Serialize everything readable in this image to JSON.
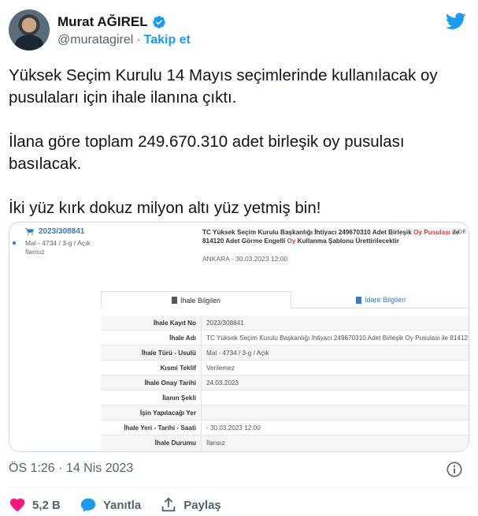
{
  "author": {
    "name": "Murat AĞIREL",
    "handle": "@muratagirel",
    "separator": "·",
    "follow_label": "Takip et"
  },
  "tweet": {
    "paragraphs": [
      "Yüksek Seçim Kurulu 14 Mayıs seçimlerinde kullanılacak oy pusulaları için ihale ilanına çıktı.",
      "İlana göre toplam 249.670.310 adet birleşik oy pusulası basılacak.",
      "İki yüz kırk dokuz milyon altı yüz yetmiş bin!"
    ],
    "timestamp": "ÖS 1:26 · 14 Nis 2023"
  },
  "media": {
    "registration": "2023/308841",
    "left_line1": "Mal - 4734 / 3-g / Açık",
    "left_line2": "İlansız",
    "title_part1": "TC Yüksek Seçim Kurulu Başkanlığı İhtiyacı 249670310 Adet Birleşik ",
    "title_red1": "Oy Pusulası",
    "title_part2": " ile 814120 Adet Görme Engelli ",
    "title_red2": "Oy",
    "title_part3": " Kullanma Şablonu Ürettirilecektir",
    "location_date": "ANKARA - 30.03.2023 12:00",
    "corner_text": "DE",
    "tab_ihale": "İhale Bilgileri",
    "tab_idare": "İdare Bilgileri",
    "rows": [
      {
        "key": "İhale Kayıt No",
        "value": "2023/308841"
      },
      {
        "key": "İhale Adı",
        "value": "TC Yüksek Seçim Kurulu Başkanlığı İhtiyacı 249670310 Adet Birleşik Oy Pusulası ile 81412"
      },
      {
        "key": "İhale Türü - Usulü",
        "value": "Mal - 4734 / 3-g / Açık"
      },
      {
        "key": "Kısmi Teklif",
        "value": "Verilemez"
      },
      {
        "key": "İhale Onay Tarihi",
        "value": "24.03.2023"
      },
      {
        "key": "İlanın Şekli",
        "value": ""
      },
      {
        "key": "İşin Yapılacağı Yer",
        "value": ""
      },
      {
        "key": "İhale Yeri - Tarihi - Saati",
        "value": "- 30.03.2023 12:00"
      },
      {
        "key": "İhale Durumu",
        "value": "İlansız"
      }
    ]
  },
  "actions": {
    "like_count": "5,2 B",
    "reply_label": "Yanıtla",
    "share_label": "Paylaş"
  },
  "colors": {
    "accent": "#1d9bf0",
    "like": "#f91880",
    "muted": "#536471"
  },
  "icons": [
    "verified-badge-icon",
    "twitter-bird-icon",
    "cart-icon",
    "info-icon",
    "heart-icon",
    "reply-icon",
    "share-icon"
  ]
}
